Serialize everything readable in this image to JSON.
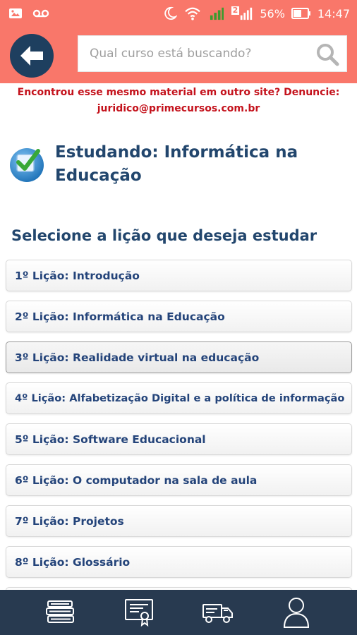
{
  "status_bar": {
    "battery": "56%",
    "time": "14:47",
    "sim_label": "2"
  },
  "header": {
    "search_placeholder": "Qual curso está buscando?"
  },
  "notice": {
    "line1": "Encontrou esse mesmo material em outro site? Denuncie:",
    "line2": "juridico@primecursos.com.br"
  },
  "course": {
    "title": "Estudando: Informática na Educação"
  },
  "section_title": "Selecione a lição que deseja estudar",
  "lessons": [
    {
      "label": "1º Lição: Introdução"
    },
    {
      "label": "2º Lição: Informática na Educação"
    },
    {
      "label": "3º Lição: Realidade virtual na educação",
      "active": true
    },
    {
      "label": "4º Lição: Alfabetização Digital e a política de informação"
    },
    {
      "label": "5º Lição: Software Educacional"
    },
    {
      "label": "6º Lição: O computador na sala de aula"
    },
    {
      "label": "7º Lição: Projetos"
    },
    {
      "label": "8º Lição: Glossário"
    }
  ],
  "bottom_nav": {
    "items": [
      "books-icon",
      "certificate-icon",
      "delivery-truck-icon",
      "user-icon"
    ]
  },
  "colors": {
    "header_bg": "#f9776a",
    "back_button": "#1e3f5f",
    "notice_text": "#c4121c",
    "title_text": "#22466d",
    "bottom_nav_bg": "#283a50"
  }
}
